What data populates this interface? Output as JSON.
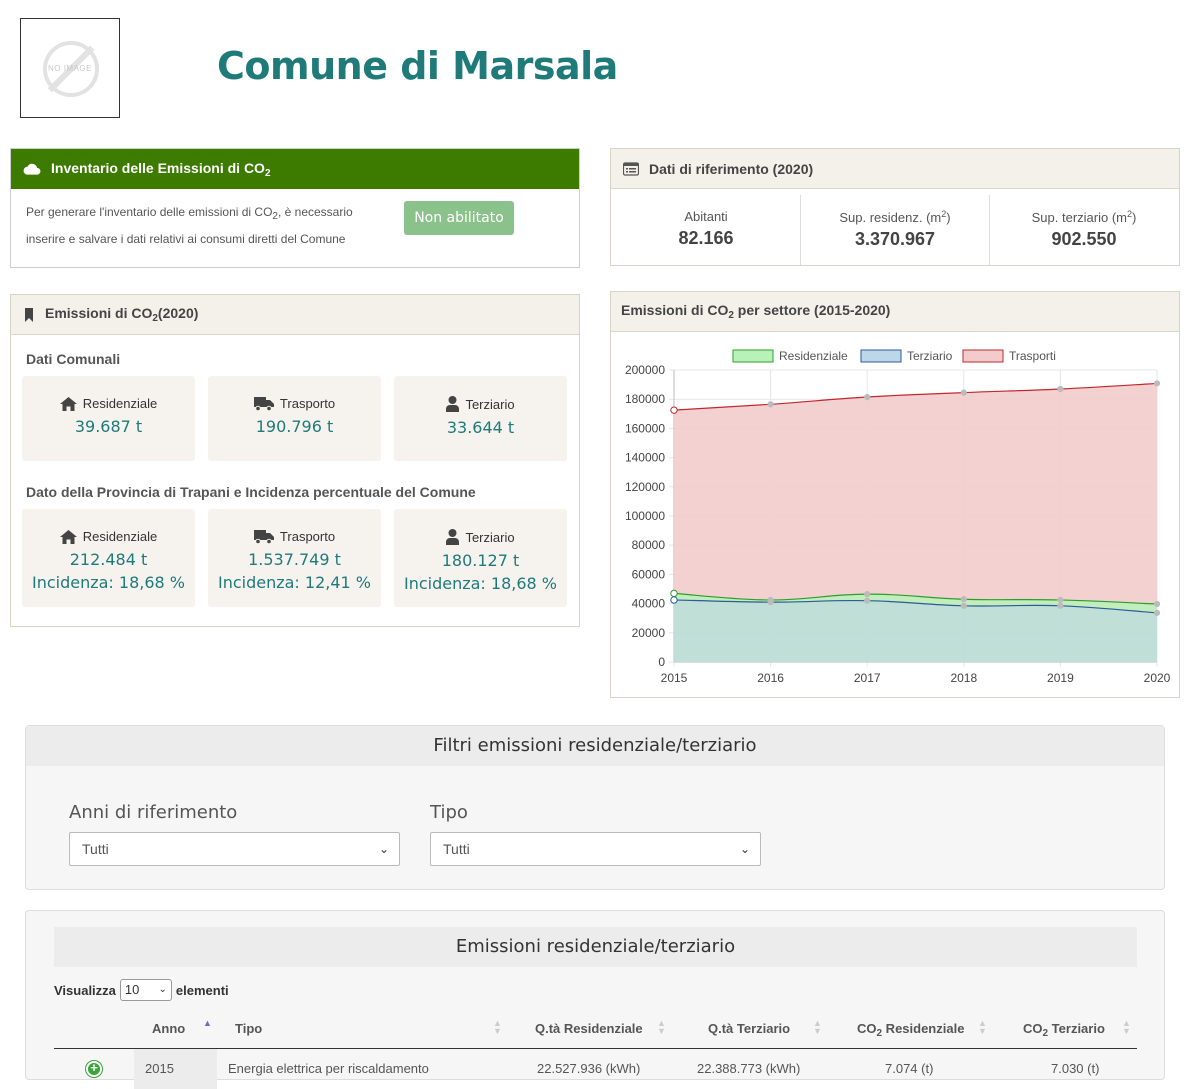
{
  "header": {
    "logo_text": "NO IMAGE",
    "city": "Comune di Marsala"
  },
  "inventario": {
    "title": "Inventario delle Emissioni di CO",
    "title_sub": "2",
    "text_a": "Per generare l'inventario delle emissioni di CO",
    "text_sub": "2",
    "text_b": ", è necessario inserire e salvare i dati relativi ai consumi diretti del Comune",
    "button": "Non abilitato"
  },
  "riferimento": {
    "title": "Dati di riferimento (2020)",
    "cells": [
      {
        "label": "Abitanti",
        "sup": "",
        "value": "82.166"
      },
      {
        "label": "Sup. residenz. (m",
        "sup": "2",
        "value": "3.370.967"
      },
      {
        "label": "Sup. terziario (m",
        "sup": "2",
        "value": "902.550"
      }
    ]
  },
  "emissioni": {
    "title_a": "Emissioni di CO",
    "title_sub": "2",
    "title_b": "(2020)",
    "comunali_title": "Dati Comunali",
    "comunali": [
      {
        "icon": "home-icon",
        "label": "Residenziale",
        "value": "39.687 t"
      },
      {
        "icon": "truck-icon",
        "label": "Trasporto",
        "value": "190.796 t"
      },
      {
        "icon": "user-icon",
        "label": "Terziario",
        "value": "33.644 t"
      }
    ],
    "provincia_title": "Dato della Provincia di Trapani e Incidenza percentuale del Comune",
    "provincia": [
      {
        "icon": "home-icon",
        "label": "Residenziale",
        "value": "212.484 t",
        "incidenza": "Incidenza: 18,68 %"
      },
      {
        "icon": "truck-icon",
        "label": "Trasporto",
        "value": "1.537.749 t",
        "incidenza": "Incidenza: 12,41 %"
      },
      {
        "icon": "user-icon",
        "label": "Terziario",
        "value": "180.127 t",
        "incidenza": "Incidenza: 18,68 %"
      }
    ]
  },
  "chart_panel": {
    "title_a": "Emissioni di CO",
    "title_sub": "2",
    "title_b": " per settore (2015-2020)"
  },
  "chart_data": {
    "type": "area",
    "x": [
      "2015",
      "2016",
      "2017",
      "2018",
      "2019",
      "2020"
    ],
    "ylim": [
      0,
      200000
    ],
    "yticks": [
      0,
      20000,
      40000,
      60000,
      80000,
      100000,
      120000,
      140000,
      160000,
      180000,
      200000
    ],
    "legend_position": "top",
    "grid": true,
    "series": [
      {
        "name": "Residenziale",
        "values": [
          47000,
          42500,
          46500,
          43000,
          42500,
          39687
        ],
        "stroke": "#2aa02a",
        "fill": "#b9f2b9"
      },
      {
        "name": "Terziario",
        "values": [
          42500,
          41000,
          42000,
          38500,
          38500,
          33644
        ],
        "stroke": "#2c5a9a",
        "fill": "#bcd6ea"
      },
      {
        "name": "Trasporti",
        "values": [
          172500,
          176500,
          181500,
          184500,
          187000,
          190796
        ],
        "stroke": "#c0282d",
        "fill": "#f2cccc"
      }
    ]
  },
  "filtri": {
    "title": "Filtri emissioni residenziale/terziario",
    "anni_label": "Anni di riferimento",
    "anni_value": "Tutti",
    "tipo_label": "Tipo",
    "tipo_value": "Tutti"
  },
  "tabella": {
    "title": "Emissioni residenziale/terziario",
    "visualizza": "Visualizza",
    "page_size": "10",
    "elementi": "elementi",
    "columns": [
      "Anno",
      "Tipo",
      "Q.tà Residenziale",
      "Q.tà Terziario",
      "CO",
      "CO"
    ],
    "col_co_res_b": " Residenziale",
    "col_co_ter_b": " Terziario",
    "co_sub": "2",
    "row": [
      "2015",
      "Energia elettrica per riscaldamento",
      "22.527.936 (kWh)",
      "22.388.773 (kWh)",
      "7.074 (t)",
      "7.030 (t)"
    ]
  }
}
